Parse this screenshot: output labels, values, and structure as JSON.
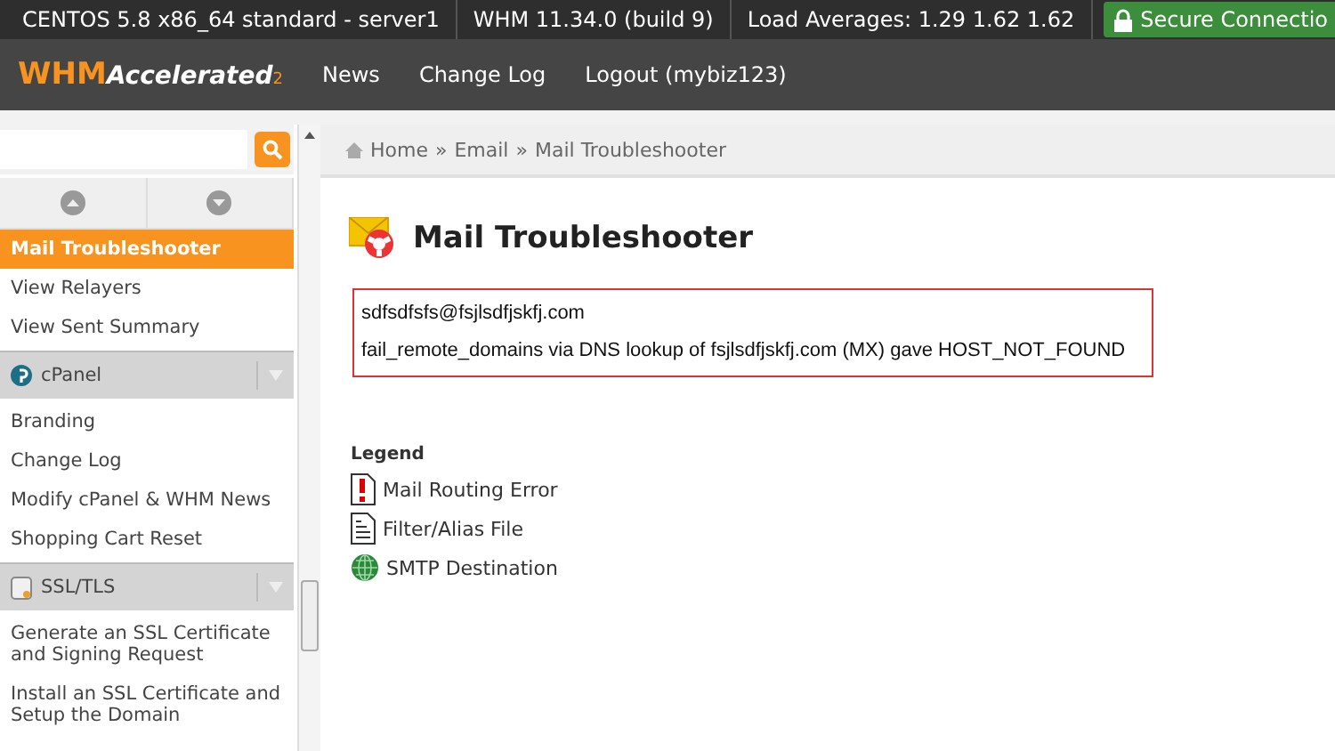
{
  "top_bar": {
    "items": [
      "CENTOS 5.8 x86_64 standard - server1",
      "WHM 11.34.0 (build 9)",
      "Load Averages: 1.29 1.62 1.62"
    ],
    "secure": "Secure Connectio"
  },
  "nav": {
    "logo": {
      "main": "WHM",
      "accent": "Accelerated",
      "sub": "2"
    },
    "links": [
      "News",
      "Change Log",
      "Logout (mybiz123)"
    ]
  },
  "sidebar": {
    "items": [
      {
        "kind": "item",
        "label": "Mail Troubleshooter",
        "selected": true
      },
      {
        "kind": "item",
        "label": "View Relayers",
        "selected": false
      },
      {
        "kind": "item",
        "label": "View Sent Summary",
        "selected": false
      },
      {
        "kind": "group",
        "label": "cPanel"
      },
      {
        "kind": "item",
        "label": "Branding",
        "selected": false
      },
      {
        "kind": "item",
        "label": "Change Log",
        "selected": false
      },
      {
        "kind": "item",
        "label": "Modify cPanel & WHM News",
        "selected": false
      },
      {
        "kind": "item",
        "label": "Shopping Cart Reset",
        "selected": false
      },
      {
        "kind": "group",
        "label": "SSL/TLS"
      },
      {
        "kind": "item",
        "label": "Generate an SSL Certificate and Signing Request",
        "selected": false
      },
      {
        "kind": "item",
        "label": "Install an SSL Certificate and Setup the Domain",
        "selected": false
      }
    ]
  },
  "breadcrumb": {
    "separator": "»",
    "items": [
      "Home",
      "Email",
      "Mail Troubleshooter"
    ]
  },
  "page_title": "Mail Troubleshooter",
  "result": [
    "sdfsdfsfs@fsjlsdfjskfj.com",
    "fail_remote_domains via DNS lookup of fsjlsdfjskfj.com (MX) gave HOST_NOT_FOUND"
  ],
  "legend": {
    "title": "Legend",
    "items": [
      {
        "kind": "error",
        "label": "Mail Routing Error"
      },
      {
        "kind": "file",
        "label": "Filter/Alias File"
      },
      {
        "kind": "smtp",
        "label": "SMTP Destination"
      }
    ]
  }
}
